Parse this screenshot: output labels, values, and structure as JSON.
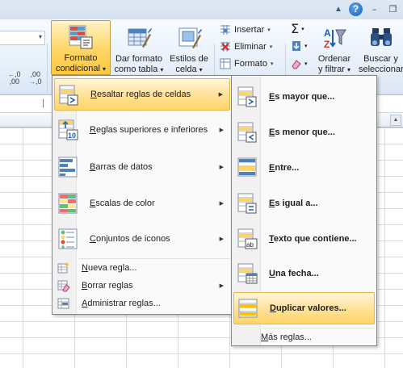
{
  "window": {
    "collapse_glyph": "▲",
    "help_glyph": "?",
    "minimize_glyph": "–",
    "restore_glyph": "❐"
  },
  "ribbon": {
    "decimals": {
      "increase_label": ",0",
      "increase_label2": ",00",
      "decrease_label": ",00",
      "decrease_label2": "→,0"
    },
    "conditional_format": {
      "line1": "Formato",
      "line2": "condicional",
      "dropdown": "▾"
    },
    "format_table": {
      "line1": "Dar formato",
      "line2": "como tabla",
      "dropdown": "▾"
    },
    "cell_styles": {
      "line1": "Estilos de",
      "line2": "celda",
      "dropdown": "▾"
    },
    "cells": {
      "insert": "Insertar",
      "delete": "Eliminar",
      "format": "Formato"
    },
    "editing": {
      "sum_icon": "Σ",
      "sort_filter": {
        "line1": "Ordenar",
        "line2": "y filtrar"
      },
      "find_select": {
        "line1": "Buscar y",
        "line2": "seleccionar"
      }
    }
  },
  "menu_main": {
    "items": [
      {
        "label": "Resaltar reglas de celdas",
        "accel": "R",
        "rest": "esaltar reglas de celdas",
        "icon": "highlight-rules-icon"
      },
      {
        "label": "Reglas superiores e inferiores",
        "accel": "R",
        "rest": "eglas superiores e inferiores",
        "icon": "top-bottom-rules-icon"
      },
      {
        "label": "Barras de datos",
        "accel": "B",
        "rest": "arras de datos",
        "icon": "data-bars-icon"
      },
      {
        "label": "Escalas de color",
        "accel": "E",
        "rest": "scalas de color",
        "icon": "color-scales-icon"
      },
      {
        "label": "Conjuntos de iconos",
        "accel": "C",
        "rest": "onjuntos de iconos",
        "icon": "icon-sets-icon"
      }
    ],
    "actions": [
      {
        "accel": "N",
        "rest": "ueva regla...",
        "icon": "new-rule-icon"
      },
      {
        "accel": "B",
        "rest": "orrar reglas",
        "icon": "clear-rules-icon"
      },
      {
        "accel": "A",
        "rest": "dministrar reglas...",
        "icon": "manage-rules-icon"
      }
    ]
  },
  "menu_sub": {
    "items": [
      {
        "accel": "E",
        "rest": "s mayor que...",
        "icon": "greater-than-icon"
      },
      {
        "accel": "E",
        "rest": "s menor que...",
        "icon": "less-than-icon"
      },
      {
        "accel": "E",
        "rest": "ntre...",
        "icon": "between-icon"
      },
      {
        "accel": "E",
        "rest": "s igual a...",
        "icon": "equal-to-icon"
      },
      {
        "accel": "T",
        "rest": "exto que contiene...",
        "icon": "text-contains-icon"
      },
      {
        "accel": "U",
        "rest": "na fecha...",
        "icon": "date-occurring-icon"
      },
      {
        "accel": "D",
        "rest": "uplicar valores...",
        "icon": "duplicate-values-icon"
      }
    ],
    "more_rules": {
      "accel": "M",
      "rest": "ás reglas..."
    }
  },
  "colors": {
    "ribbon_active": "#ffd86b",
    "menu_highlight": "#ffe29b",
    "accent_blue": "#1a5fb4"
  }
}
